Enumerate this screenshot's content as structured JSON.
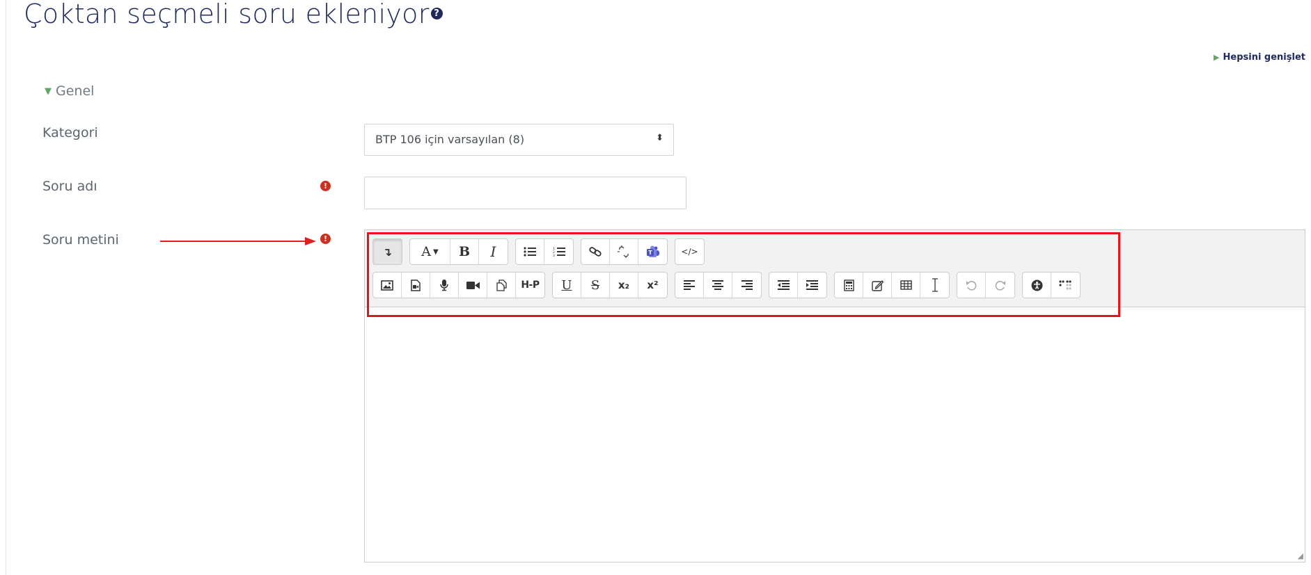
{
  "page": {
    "title": "Çoktan seçmeli soru ekleniyor",
    "help_icon": "question-circle-icon",
    "expand_all": "Hepsini genişlet"
  },
  "section": {
    "header": "Genel",
    "collapse_icon": "caret-down-icon"
  },
  "form": {
    "category": {
      "label": "Kategori",
      "selected": "BTP 106 için varsayılan (8)"
    },
    "question_name": {
      "label": "Soru adı",
      "value": "",
      "required_icon": "exclamation-circle-icon"
    },
    "question_text": {
      "label": "Soru metini",
      "required_icon": "exclamation-circle-icon"
    }
  },
  "toolbar": {
    "row1": [
      [
        "show-more-buttons-icon"
      ],
      [
        "font-size-icon",
        "bold-icon",
        "italic-icon"
      ],
      [
        "unordered-list-icon",
        "ordered-list-icon"
      ],
      [
        "link-icon",
        "unlink-icon",
        "teams-meeting-icon"
      ],
      [
        "html-source-icon"
      ]
    ],
    "row2": [
      [
        "image-icon",
        "media-icon",
        "record-audio-icon",
        "record-video-icon",
        "manage-files-icon",
        "h5p-icon"
      ],
      [
        "underline-icon",
        "strikethrough-icon",
        "subscript-icon",
        "superscript-icon"
      ],
      [
        "align-left-icon",
        "align-center-icon",
        "align-right-icon"
      ],
      [
        "outdent-icon",
        "indent-icon"
      ],
      [
        "equation-icon",
        "special-character-icon",
        "table-icon",
        "clear-formatting-icon"
      ],
      [
        "undo-icon",
        "redo-icon"
      ],
      [
        "accessibility-checker-icon",
        "screen-reader-helper-icon"
      ]
    ],
    "glyphs": {
      "font_size": "A",
      "bold": "B",
      "italic": "I",
      "underline": "U",
      "strikethrough": "S",
      "subscript": "x₂",
      "superscript": "x²",
      "h5p": "H-P",
      "html_source": "</>"
    }
  },
  "colors": {
    "title": "#1d2a5b",
    "required": "#ca3120",
    "section_caret": "#5fa763",
    "annotation": "#e8121b"
  }
}
